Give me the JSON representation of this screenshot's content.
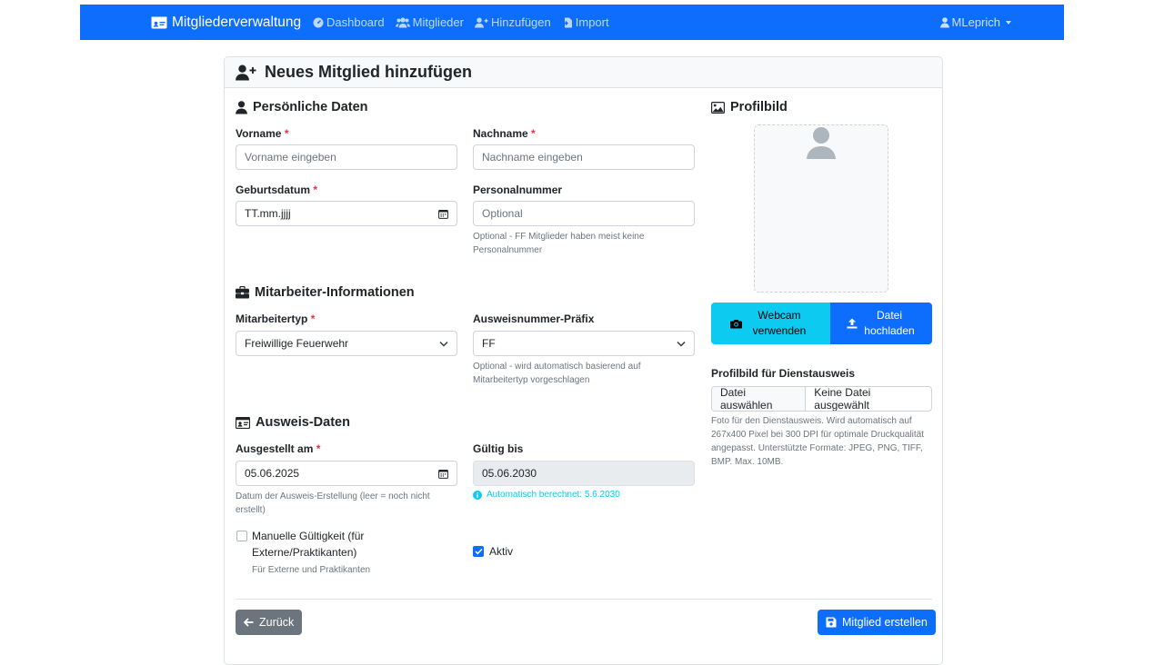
{
  "navbar": {
    "brand": "Mitgliederverwaltung",
    "links": [
      {
        "label": "Dashboard"
      },
      {
        "label": "Mitglieder"
      },
      {
        "label": "Hinzufügen"
      },
      {
        "label": "Import"
      }
    ],
    "user": "MLeprich"
  },
  "page": {
    "title": "Neues Mitglied hinzufügen"
  },
  "personal": {
    "title": "Persönliche Daten",
    "first_name": {
      "label": "Vorname",
      "required": "*",
      "placeholder": "Vorname eingeben"
    },
    "last_name": {
      "label": "Nachname",
      "required": "*",
      "placeholder": "Nachname eingeben"
    },
    "birthdate": {
      "label": "Geburtsdatum",
      "required": "*",
      "value": "TT.mm.jjjj"
    },
    "personnel_no": {
      "label": "Personalnummer",
      "placeholder": "Optional",
      "help": "Optional - FF Mitglieder haben meist keine Personalnummer"
    }
  },
  "employee": {
    "title": "Mitarbeiter-Informationen",
    "type": {
      "label": "Mitarbeitertyp",
      "required": "*",
      "value": "Freiwillige Feuerwehr"
    },
    "prefix": {
      "label": "Ausweisnummer-Präfix",
      "value": "FF",
      "help": "Optional - wird automatisch basierend auf Mitarbeitertyp vorgeschlagen"
    }
  },
  "id_card": {
    "title": "Ausweis-Daten",
    "issued": {
      "label": "Ausgestellt am",
      "required": "*",
      "value": "05.06.2025",
      "help": "Datum der Ausweis-Erstellung (leer = noch nicht erstellt)"
    },
    "valid_until": {
      "label": "Gültig bis",
      "value": "05.06.2030",
      "info": "Automatisch berechnet: 5.6.2030"
    },
    "manual_validity": {
      "label": "Manuelle Gültigkeit (für Externe/Praktikanten)",
      "help": "Für Externe und Praktikanten",
      "checked": false
    },
    "active": {
      "label": "Aktiv",
      "checked": true
    }
  },
  "profile": {
    "title": "Profilbild",
    "webcam_button": "Webcam verwenden",
    "upload_button": "Datei hochladen",
    "file_label": "Profilbild für Dienstausweis",
    "file_button": "Datei auswählen",
    "file_status": "Keine Datei ausgewählt",
    "help": "Foto für den Dienstausweis. Wird automatisch auf 267x400 Pixel bei 300 DPI für optimale Druckqualität angepasst. Unterstützte Formate: JPEG, PNG, TIFF, BMP. Max. 10MB."
  },
  "actions": {
    "back": "Zurück",
    "create": "Mitglied erstellen"
  },
  "colors": {
    "primary": "#0d6efd",
    "info": "#0dcaf0",
    "secondary": "#6c757d",
    "danger": "#dc3545"
  }
}
